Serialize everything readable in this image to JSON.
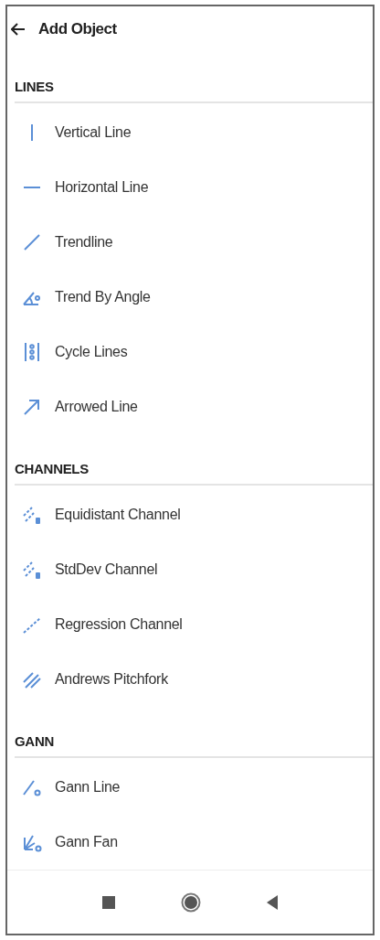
{
  "header": {
    "title": "Add Object"
  },
  "sections": [
    {
      "title": "LINES",
      "items": [
        {
          "label": "Vertical Line"
        },
        {
          "label": "Horizontal Line"
        },
        {
          "label": "Trendline"
        },
        {
          "label": "Trend By Angle"
        },
        {
          "label": "Cycle Lines"
        },
        {
          "label": "Arrowed Line"
        }
      ]
    },
    {
      "title": "CHANNELS",
      "items": [
        {
          "label": "Equidistant Channel"
        },
        {
          "label": "StdDev Channel"
        },
        {
          "label": "Regression Channel"
        },
        {
          "label": "Andrews Pitchfork"
        }
      ]
    },
    {
      "title": "GANN",
      "items": [
        {
          "label": "Gann Line"
        },
        {
          "label": "Gann Fan"
        }
      ]
    }
  ]
}
